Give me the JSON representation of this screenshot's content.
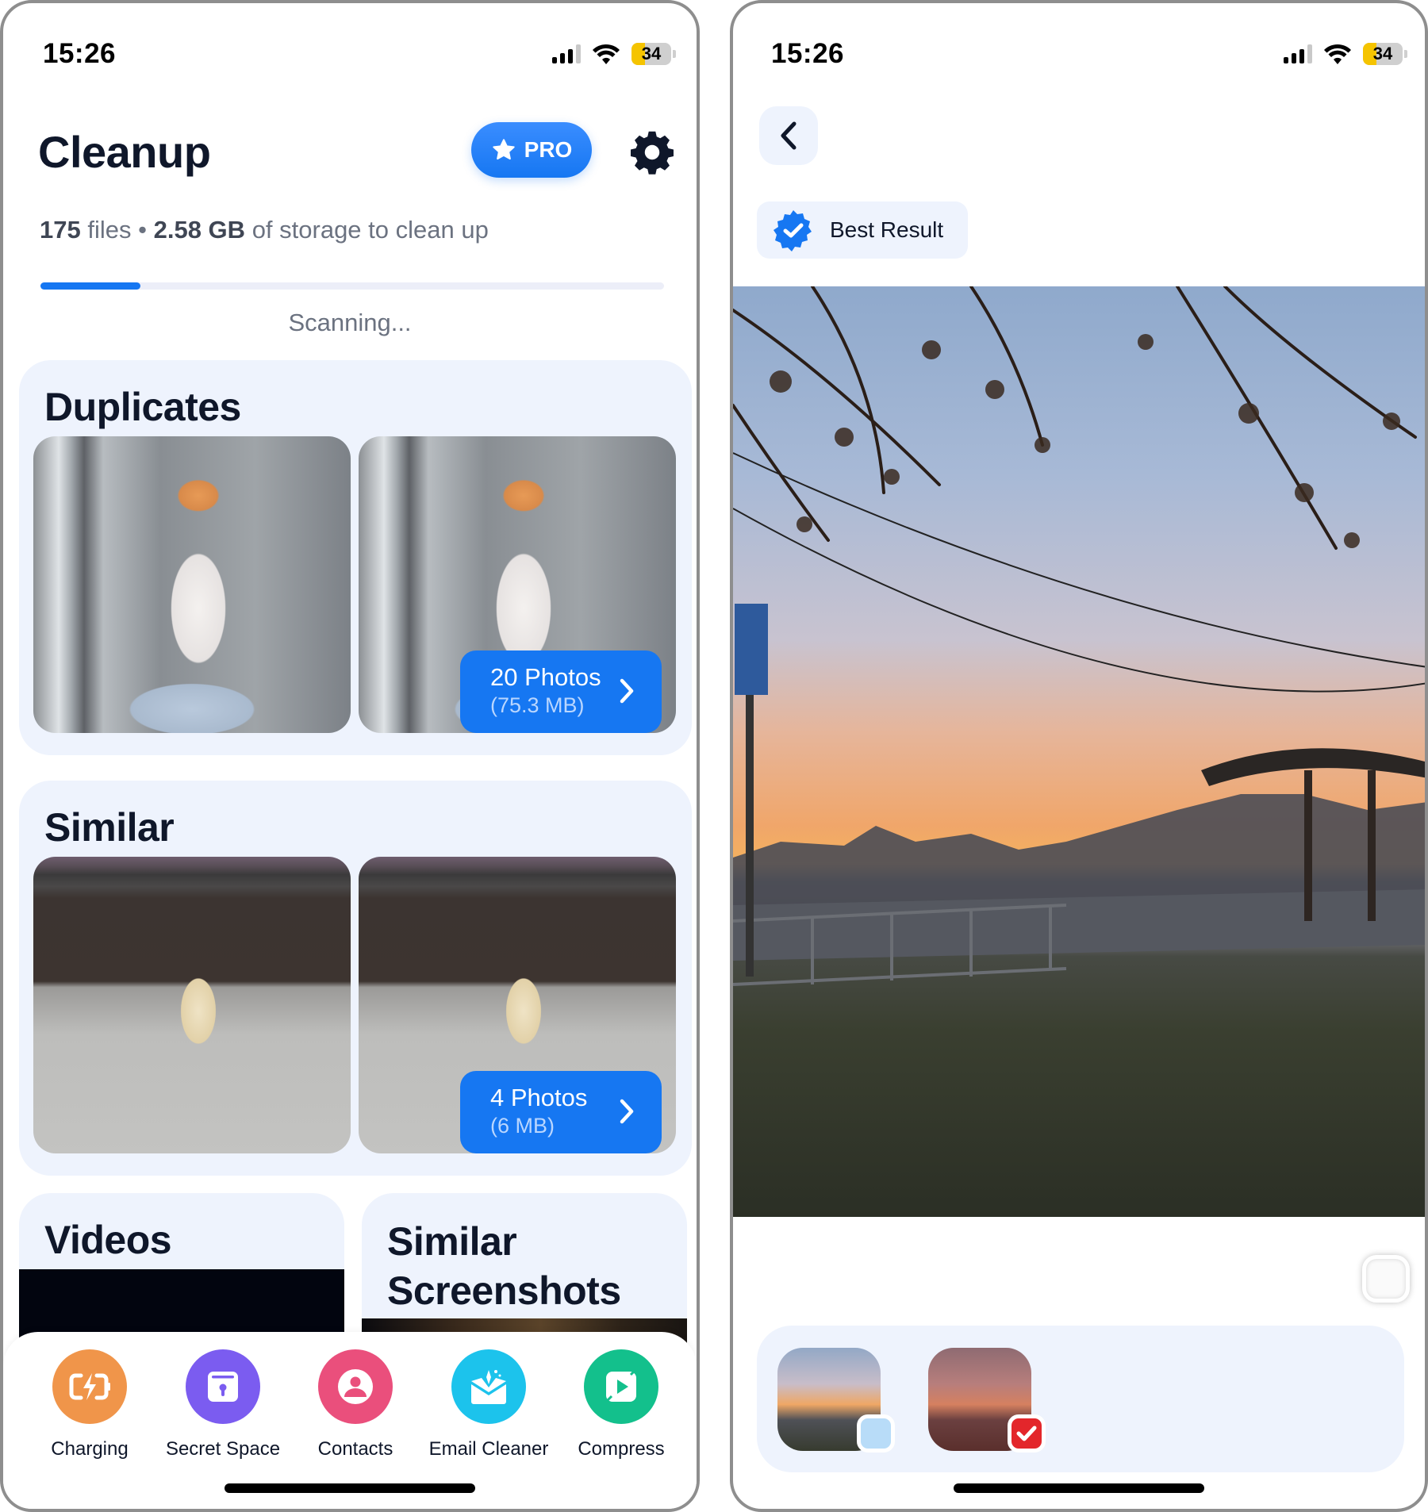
{
  "left_screen": {
    "status_bar": {
      "time": "15:26",
      "battery": "34",
      "battery_level_percent": 34,
      "battery_color": "#f5c400"
    },
    "title": "Cleanup",
    "pro_button": {
      "label": "PRO",
      "color": "#1677f2"
    },
    "summary": {
      "files_count": "175",
      "files_label": "files",
      "separator": "•",
      "size": "2.58 GB",
      "size_suffix": "of storage to clean up"
    },
    "scan_progress_percent": 16,
    "scanning_label": "Scanning...",
    "sections": {
      "duplicates": {
        "title": "Duplicates",
        "count_label": "20 Photos",
        "size_label": "(75.3 MB)"
      },
      "similar": {
        "title": "Similar",
        "count_label": "4 Photos",
        "size_label": "(6 MB)"
      },
      "videos": {
        "title": "Videos"
      },
      "similar_screenshots": {
        "title_line1": "Similar",
        "title_line2": "Screenshots"
      }
    },
    "tab_bar": [
      {
        "label": "Charging",
        "icon": "charging-icon",
        "color": "#f0954a"
      },
      {
        "label": "Secret Space",
        "icon": "lock-folder-icon",
        "color": "#7b5cf0"
      },
      {
        "label": "Contacts",
        "icon": "contact-icon",
        "color": "#ea4f7c"
      },
      {
        "label": "Email Cleaner",
        "icon": "email-sparkle-icon",
        "color": "#1cc3ec"
      },
      {
        "label": "Compress",
        "icon": "compress-video-icon",
        "color": "#13c08c"
      }
    ]
  },
  "right_screen": {
    "status_bar": {
      "time": "15:26",
      "battery": "34",
      "battery_level_percent": 34
    },
    "back_button": {
      "icon": "chevron-left-icon"
    },
    "best_result_chip": {
      "label": "Best Result",
      "icon": "verified-badge-icon",
      "color": "#1677f2"
    },
    "main_photo": {
      "subject": "sunset street scene with bus stop"
    },
    "select_checkbox": {
      "checked": false
    },
    "thumbnails": [
      {
        "selected_for_deletion": false,
        "check_color": "#b8dcf8"
      },
      {
        "selected_for_deletion": true,
        "check_color": "#e3262b"
      }
    ]
  }
}
